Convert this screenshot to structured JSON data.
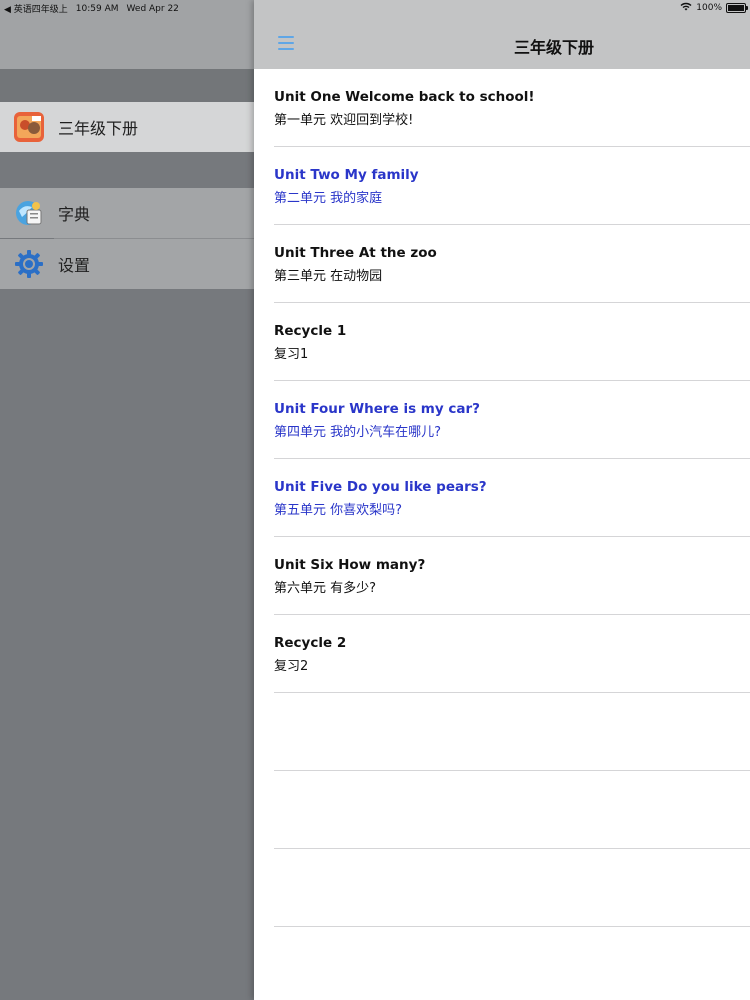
{
  "status_bar": {
    "back_app": "◀ 英语四年级上",
    "time": "10:59 AM",
    "date": "Wed Apr 22",
    "battery": "100%"
  },
  "sidebar": {
    "items": [
      {
        "label": "三年级下册",
        "icon": "book-cover-icon",
        "selected": true
      },
      {
        "label": "字典",
        "icon": "dictionary-icon",
        "selected": false
      },
      {
        "label": "设置",
        "icon": "gear-icon",
        "selected": false
      }
    ]
  },
  "header": {
    "title": "三年级下册",
    "menu_icon": "hamburger-menu-icon"
  },
  "units": [
    {
      "en": "Unit One Welcome back to school!",
      "zh": "第一单元 欢迎回到学校!",
      "highlight": false
    },
    {
      "en": "Unit Two My family",
      "zh": "第二单元 我的家庭",
      "highlight": true
    },
    {
      "en": "Unit Three At the zoo",
      "zh": "第三单元 在动物园",
      "highlight": false
    },
    {
      "en": "Recycle 1",
      "zh": "复习1",
      "highlight": false
    },
    {
      "en": "Unit Four Where is my car?",
      "zh": "第四单元 我的小汽车在哪儿?",
      "highlight": true
    },
    {
      "en": "Unit Five Do you like pears?",
      "zh": "第五单元 你喜欢梨吗?",
      "highlight": true
    },
    {
      "en": "Unit Six How many?",
      "zh": "第六单元 有多少?",
      "highlight": false
    },
    {
      "en": "Recycle 2",
      "zh": "复习2",
      "highlight": false
    }
  ],
  "colors": {
    "highlight_text": "#2a36c9",
    "menu_accent": "#5fa6e6"
  }
}
